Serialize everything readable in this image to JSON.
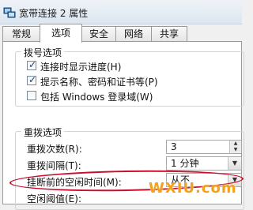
{
  "window": {
    "title": "宽带连接 2 属性",
    "icon": "network-connection-icon"
  },
  "tabs": [
    {
      "label": "常规",
      "active": false
    },
    {
      "label": "选项",
      "active": true
    },
    {
      "label": "安全",
      "active": false
    },
    {
      "label": "网络",
      "active": false
    },
    {
      "label": "共享",
      "active": false
    }
  ],
  "dial_options": {
    "legend": "拨号选项",
    "items": [
      {
        "label": "连接时显示进度(H)",
        "checked": true
      },
      {
        "label": "提示名称、密码和证书等(P)",
        "checked": true
      },
      {
        "label": "包括 Windows 登录域(W)",
        "checked": false
      }
    ]
  },
  "redial_options": {
    "legend": "重拨选项",
    "attempts_label": "重拨次数(R):",
    "attempts_value": "3",
    "interval_label": "重拨间隔(T):",
    "interval_value": "1 分钟",
    "idle_label": "挂断前的空闲时间(M):",
    "idle_value": "从不",
    "threshold_label": "空闲阈值(E):"
  },
  "watermark": "WXIU.com",
  "colors": {
    "highlight": "#c8102e",
    "watermark": "#f5a11a"
  }
}
